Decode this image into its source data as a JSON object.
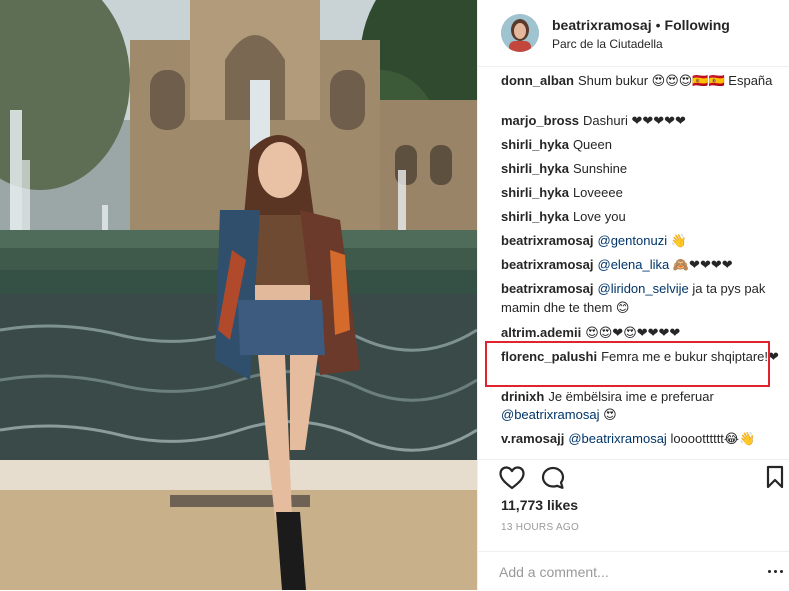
{
  "header": {
    "username": "beatrixramosaj",
    "separator": "•",
    "follow_status": "Following",
    "location": "Parc de la Ciutadella"
  },
  "comments": [
    {
      "user": "donn_alban",
      "mention": "",
      "text": "Shum bukur 😍😍😍🇪🇸🇪🇸 España"
    },
    {
      "user": "marjo_bross",
      "mention": "",
      "text": "Dashuri ❤❤❤❤❤"
    },
    {
      "user": "shirli_hyka",
      "mention": "",
      "text": "Queen"
    },
    {
      "user": "shirli_hyka",
      "mention": "",
      "text": "Sunshine"
    },
    {
      "user": "shirli_hyka",
      "mention": "",
      "text": "Loveeee"
    },
    {
      "user": "shirli_hyka",
      "mention": "",
      "text": "Love you"
    },
    {
      "user": "beatrixramosaj",
      "mention": "@gentonuzi",
      "text": "👋"
    },
    {
      "user": "beatrixramosaj",
      "mention": "@elena_lika",
      "text": "🙈❤❤❤❤"
    },
    {
      "user": "beatrixramosaj",
      "mention": "@liridon_selvije",
      "text": "ja ta pys pak mamin dhe te them 😊",
      "highlighted": true
    },
    {
      "user": "altrim.ademii",
      "mention": "",
      "text": "😍😍❤😍❤❤❤❤"
    },
    {
      "user": "florenc_palushi",
      "mention": "",
      "text": "Femra me e bukur shqiptare!❤"
    },
    {
      "user": "drinixh",
      "mention": "",
      "text": "Je ëmbëlsira ime e preferuar"
    },
    {
      "user": "",
      "mention": "@beatrixramosaj",
      "text": "😍"
    },
    {
      "user": "v.ramosajj",
      "mention": "@beatrixramosaj",
      "text": "looootttttt😂👋"
    }
  ],
  "actions": {
    "like_icon": "heart-outline-icon",
    "comment_icon": "speech-bubble-icon",
    "save_icon": "bookmark-icon",
    "likes_count": "11,773 likes",
    "time_ago": "13 HOURS AGO"
  },
  "add_comment": {
    "placeholder": "Add a comment...",
    "more_icon": "more-dots-icon"
  },
  "colors": {
    "text": "#262626",
    "mention": "#003569",
    "muted": "#999999",
    "highlight_box": "#e0232c",
    "divider": "#efefef"
  }
}
